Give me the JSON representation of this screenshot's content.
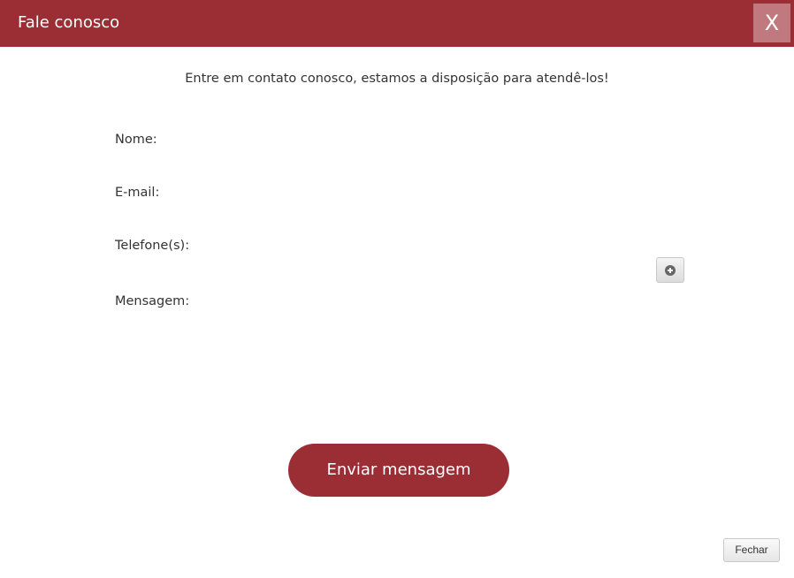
{
  "dialog": {
    "title": "Fale conosco",
    "close_label": "X"
  },
  "intro_text": "Entre em contato conosco, estamos a disposição para atendê-los!",
  "form": {
    "name_label": "Nome:",
    "name_value": "",
    "email_label": "E-mail:",
    "email_value": "",
    "phone_label": "Telefone(s):",
    "phone_value": "",
    "add_phone_icon": "plus-circle-icon",
    "message_label": "Mensagem:",
    "message_value": ""
  },
  "send_button_label": "Enviar mensagem",
  "footer": {
    "close_label": "Fechar"
  },
  "colors": {
    "primary": "#9b2d35",
    "close_button": "#c07a7f"
  }
}
